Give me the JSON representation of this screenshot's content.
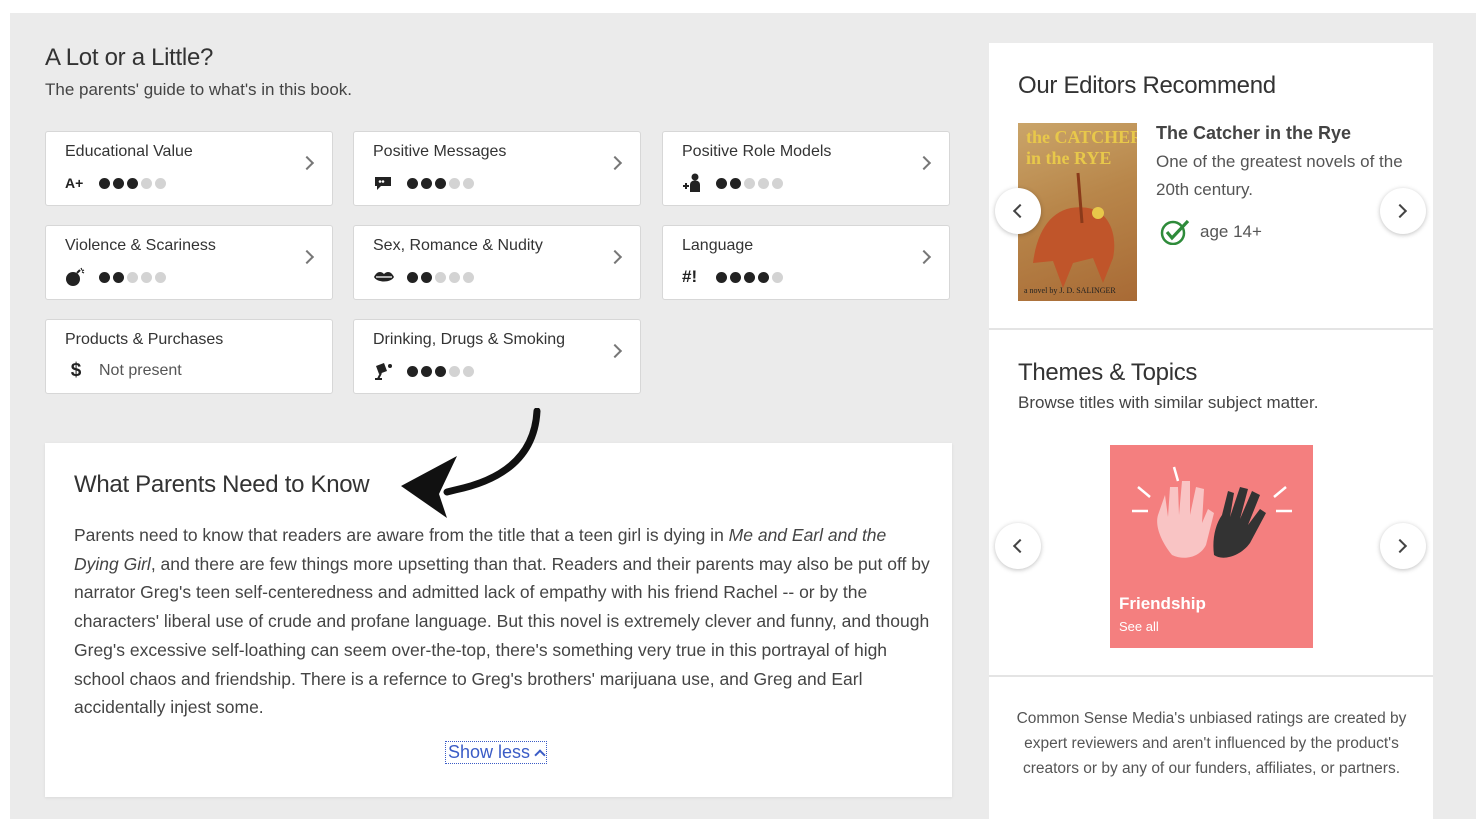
{
  "guide": {
    "title": "A Lot or a Little?",
    "subtitle": "The parents' guide to what's in this book."
  },
  "ratings": [
    {
      "label": "Educational Value",
      "icon": "A+",
      "icon_name": "grade-icon",
      "level": 3,
      "max": 5
    },
    {
      "label": "Positive Messages",
      "icon_name": "speech-bubble-icon",
      "level": 3,
      "max": 5
    },
    {
      "label": "Positive Role Models",
      "icon_name": "role-model-icon",
      "level": 2,
      "max": 5
    },
    {
      "label": "Violence & Scariness",
      "icon_name": "bomb-icon",
      "level": 2,
      "max": 5
    },
    {
      "label": "Sex, Romance & Nudity",
      "icon_name": "lips-icon",
      "level": 2,
      "max": 5
    },
    {
      "label": "Language",
      "icon": "#!",
      "icon_name": "profanity-icon",
      "level": 4,
      "max": 5
    },
    {
      "label": "Products & Purchases",
      "icon": "$",
      "icon_name": "dollar-icon",
      "status": "Not present"
    },
    {
      "label": "Drinking, Drugs & Smoking",
      "icon_name": "glass-icon",
      "level": 3,
      "max": 5
    }
  ],
  "wpntk": {
    "title": "What Parents Need to Know",
    "p1": "Parents need to know that readers are aware from the title that a teen girl is dying in ",
    "book_italic": "Me and Earl and the Dying Girl",
    "p2": ", and there are few things more upsetting than that. Readers and their parents may also be put off by narrator Greg's teen self-centeredness and admitted lack of empathy with his friend Rachel -- or by the characters' liberal use of crude and profane language. But this novel is extremely clever and funny, and though Greg's excessive self-loathing can seem over-the-top, there's something very true in this portrayal of high school chaos and friendship. There is a refernce to Greg's brothers' marijuana use, and Greg and Earl accidentally injest some.",
    "show_less": "Show less"
  },
  "editors": {
    "title": "Our Editors Recommend",
    "book_title": "The Catcher in the Rye",
    "book_desc": "One of the greatest novels of the 20th century.",
    "age": "age 14+",
    "cover_line1": "the CATCHER",
    "cover_line2": "in the RYE",
    "cover_author": "a novel by J. D. SALINGER"
  },
  "themes": {
    "title": "Themes & Topics",
    "subtitle": "Browse titles with similar subject matter.",
    "topic": "Friendship",
    "see_all": "See all"
  },
  "csm_note": "Common Sense Media's unbiased ratings are created by expert reviewers and aren't influenced by the product's creators or by any of our funders, affiliates, or partners.",
  "colors": {
    "accent_link": "#3b5cc6",
    "topic_tile": "#f47f7f",
    "age_check": "#2e8b3a"
  }
}
